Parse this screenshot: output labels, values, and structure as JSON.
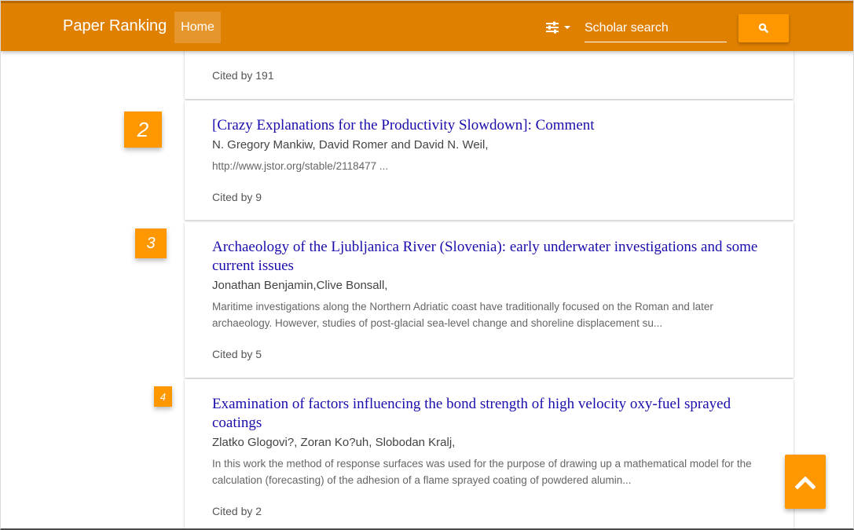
{
  "navbar": {
    "brand": "Paper Ranking",
    "home_label": "Home",
    "filter_icon": "sliders-icon",
    "search_placeholder": "Scholar search",
    "search_icon": "search-icon"
  },
  "results": [
    {
      "rank": "",
      "title": "",
      "authors": "",
      "abstract": "",
      "cited": "Cited by 191"
    },
    {
      "rank": "2",
      "title": "[Crazy Explanations for the Productivity Slowdown]: Comment",
      "authors": "N. Gregory Mankiw, David Romer and David N. Weil,",
      "abstract": "http://www.jstor.org/stable/2118477 ...",
      "cited": "Cited by 9"
    },
    {
      "rank": "3",
      "title": "Archaeology of the Ljubljanica River (Slovenia): early underwater investigations and some current issues",
      "authors": "Jonathan Benjamin,Clive Bonsall,",
      "abstract": "Maritime investigations along the Northern Adriatic coast have traditionally focused on the Roman and later archaeology. However, studies of post-glacial sea-level change and shoreline displacement su...",
      "cited": "Cited by 5"
    },
    {
      "rank": "4",
      "title": "Examination of factors influencing the bond strength of high velocity oxy-fuel sprayed coatings",
      "authors": "Zlatko Glogovi?, Zoran Ko?uh, Slobodan Kralj,",
      "abstract": "In this work the method of response surfaces was used for the purpose of drawing up a mathematical model for the calculation (forecasting) of the adhesion of a flame sprayed coating of powdered alumin...",
      "cited": "Cited by 2"
    }
  ],
  "back_to_top_icon": "chevron-up-icon",
  "colors": {
    "navbar": "#e08000",
    "accent": "#ff9800",
    "title_link": "#1a0dab"
  }
}
